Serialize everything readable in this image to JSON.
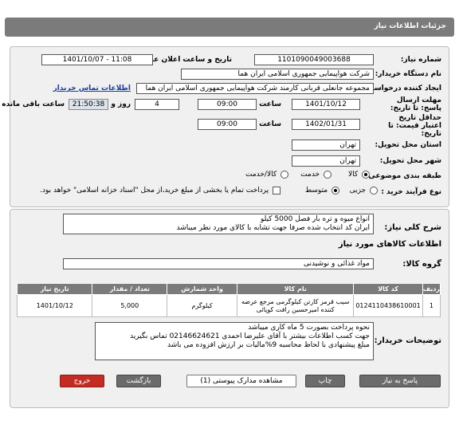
{
  "header": {
    "title": "جزئیات اطلاعات نیاز"
  },
  "form": {
    "need_number_label": "شماره نیاز:",
    "need_number": "1101090049003688",
    "announce_label": "تاریخ و ساعت اعلان عمومی:",
    "announce_value": "1401/10/07 - 11:08",
    "buyer_label": "نام دستگاه خریدار:",
    "buyer_value": "شرکت هواپیمایی جمهوری اسلامی ایران هما",
    "creator_label": "ایجاد کننده درخواست:",
    "creator_value": "مجموعه جانعلی قربانی کارمند شرکت هواپیمایی جمهوری اسلامی ایران هما",
    "contact_link": "اطلاعات تماس خریدار",
    "deadline_label": "مهلت ارسال پاسخ: تا تاریخ:",
    "deadline_date": "1401/10/12",
    "time_label": "ساعت",
    "deadline_time": "09:00",
    "day_label": "روز و",
    "days": "4",
    "remaining": "21:50:38",
    "remaining_label": "ساعت باقی مانده",
    "validity_label": "حداقل تاریخ اعتبار قیمت: تا تاریخ:",
    "validity_date": "1402/01/31",
    "validity_time_label": "ساعت",
    "validity_time": "09:00",
    "province_label": "استان محل تحویل:",
    "province": "تهران",
    "city_label": "شهر محل تحویل:",
    "city": "تهران",
    "category_label": "طبقه بندی موضوعی:",
    "cat_goods": "کالا",
    "cat_service": "خدمت",
    "cat_both": "کالا/خدمت",
    "process_label": "نوع فرآیند خرید :",
    "proc_partial": "جزیی",
    "proc_medium": "متوسط",
    "payment_note": "پرداخت تمام یا بخشی از مبلغ خرید،از محل \"اسناد خزانه اسلامی\" خواهد بود."
  },
  "details": {
    "summary_label": "شرح کلی نیاز:",
    "summary_line1": "انواع میوه و تره بار فصل  5000 کیلو",
    "summary_line2": "ایران کد انتخاب شده صرفا جهت تشابه با کالای مورد نظر میباشد",
    "goods_info_title": "اطلاعات کالاهای مورد نیاز",
    "group_label": "گروه کالا:",
    "group_value": "مواد غذائی و نوشیدنی",
    "notes_label": "توضیحات خریدار:",
    "notes_line1": "نحوه پرداخت بصورت 5 ماه کاری میباشد",
    "notes_line2": "جهت کسب اطلاعات بیشتر با آقای علیرضا احمدی  02146624621  تماس بگیرید",
    "notes_line3": "مبلغ پیشنهادی با لحاظ محاسبه 9%مالیات بر ارزش افزوده می باشد"
  },
  "table": {
    "headers": [
      "ردیف",
      "کد کالا",
      "نام کالا",
      "واحد شمارش",
      "تعداد / مقدار",
      "تاریخ نیاز"
    ],
    "rows": [
      [
        "1",
        "0124110438610001",
        "سیب قرمز کارتن کیلوگرمی مرجع عرضه کننده امیرحسین رافت کوپائی",
        "کیلوگرم",
        "5,000",
        "1401/10/12"
      ]
    ]
  },
  "buttons": {
    "reply": "پاسخ به نیاز",
    "print": "چاپ",
    "attachments": "مشاهده مدارک پیوستی (1)",
    "back": "بازگشت",
    "exit": "خروج"
  }
}
